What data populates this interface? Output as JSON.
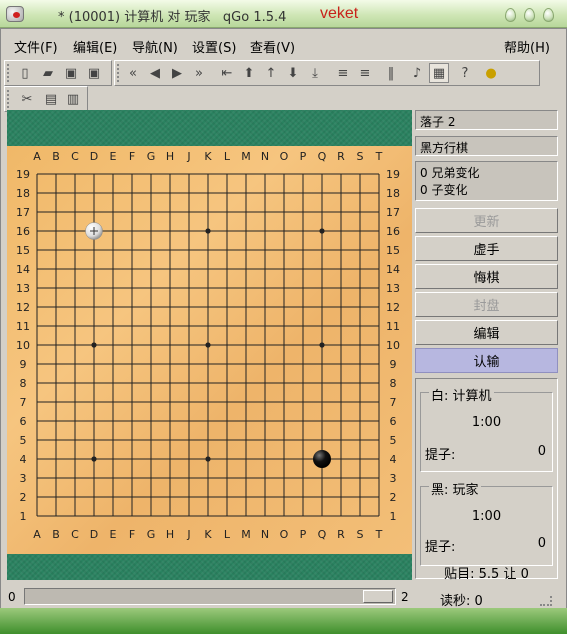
{
  "window": {
    "title": "* (10001) 计算机 对 玩家   qGo 1.5.4",
    "brand": "veket"
  },
  "menu": {
    "file": "文件(F)",
    "edit": "编辑(E)",
    "navigate": "导航(N)",
    "settings": "设置(S)",
    "view": "查看(V)",
    "help": "帮助(H)"
  },
  "toolbar_icons": {
    "file": [
      "new-document-icon",
      "open-folder-icon",
      "save-icon",
      "save-as-icon"
    ],
    "navigation": [
      "first-move-icon",
      "previous-move-icon",
      "next-move-icon",
      "last-move-icon",
      "previous-variation-icon",
      "up-icon",
      "main-branch-icon",
      "down-icon",
      "next-variation-icon",
      "previous-comment-icon",
      "next-comment-icon",
      "pause-icon",
      "sound-icon",
      "coordinates-icon",
      "help-icon",
      "hint-icon"
    ],
    "edit": [
      "cut-icon",
      "copy-icon",
      "paste-icon"
    ]
  },
  "board": {
    "columns": [
      "A",
      "B",
      "C",
      "D",
      "E",
      "F",
      "G",
      "H",
      "J",
      "K",
      "L",
      "M",
      "N",
      "O",
      "P",
      "Q",
      "R",
      "S",
      "T"
    ],
    "size": 19,
    "hoshi": [
      [
        4,
        4
      ],
      [
        10,
        4
      ],
      [
        16,
        4
      ],
      [
        4,
        10
      ],
      [
        10,
        10
      ],
      [
        16,
        10
      ],
      [
        4,
        16
      ],
      [
        10,
        16
      ],
      [
        16,
        16
      ]
    ],
    "stones": [
      {
        "color": "black",
        "col": 16,
        "row": 4
      }
    ],
    "hover_stone": {
      "color": "white",
      "col": 4,
      "row": 16
    },
    "colors": {
      "board": "#f3bf78",
      "line": "#222222",
      "frame": "#2a8260"
    }
  },
  "side": {
    "move": "落子 2",
    "turn": "黑方行棋",
    "siblings": "0 兄弟变化",
    "children": "0 子变化",
    "buttons": {
      "update": "更新",
      "pass": "虚手",
      "undo": "悔棋",
      "adjourn": "封盘",
      "edit": "编辑",
      "resign": "认输"
    },
    "white": {
      "title": "白: 计算机",
      "time": "1:00",
      "captures_label": "提子:",
      "captures": "0"
    },
    "black": {
      "title": "黑: 玩家",
      "time": "1:00",
      "captures_label": "提子:",
      "captures": "0"
    },
    "komi": "贴目: 5.5 让 0",
    "byoyomi": "读秒: 0"
  },
  "status": {
    "slider_min": "0",
    "slider_max": "2",
    "slider_value": 2
  }
}
